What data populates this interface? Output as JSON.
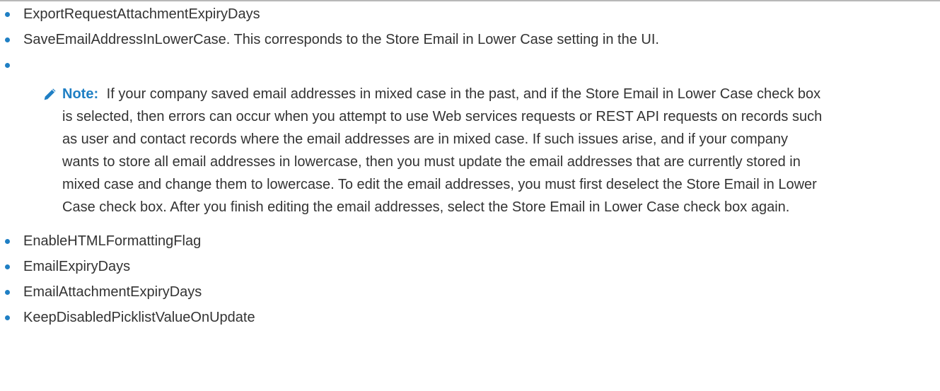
{
  "items": [
    {
      "text": "ExportRequestAttachmentExpiryDays"
    },
    {
      "text": "SaveEmailAddressInLowerCase. This corresponds to the Store Email in Lower Case setting in the UI."
    },
    {
      "text": ""
    },
    {
      "text": "EnableHTMLFormattingFlag"
    },
    {
      "text": "EmailExpiryDays"
    },
    {
      "text": "EmailAttachmentExpiryDays"
    },
    {
      "text": "KeepDisabledPicklistValueOnUpdate"
    }
  ],
  "note": {
    "icon": "pencil-icon",
    "label": "Note:",
    "body": "If your company saved email addresses in mixed case in the past, and if the Store Email in Lower Case check box is selected, then errors can occur when you attempt to use Web services requests or REST API requests on records such as user and contact records where the email addresses are in mixed case. If such issues arise, and if your company wants to store all email addresses in lowercase, then you must update the email addresses that are currently stored in mixed case and change them to lowercase. To edit the email addresses, you must first deselect the Store Email in Lower Case check box. After you finish editing the email addresses, select the Store Email in Lower Case check box again."
  },
  "colors": {
    "accent": "#1f7fc4",
    "text": "#333333",
    "rule": "#b8b8b8"
  }
}
